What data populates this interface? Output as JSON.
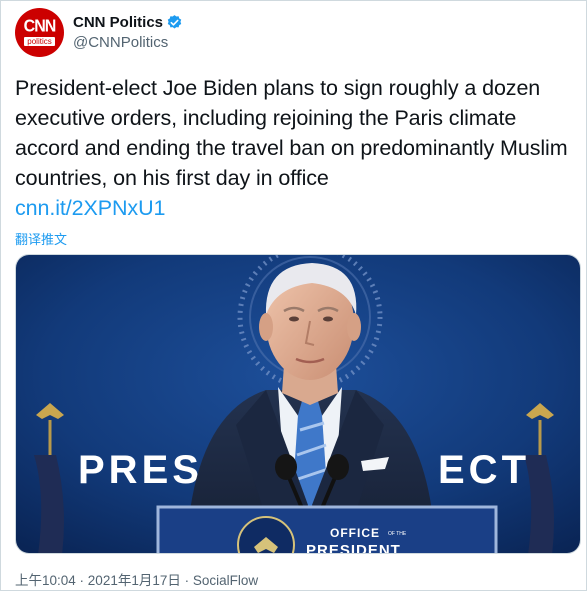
{
  "account": {
    "display_name": "CNN Politics",
    "handle": "@CNNPolitics",
    "avatar_logo": "CNN",
    "avatar_sub": "politics",
    "verified": true,
    "brand_color": "#cc0000"
  },
  "tweet": {
    "text": "President-elect Joe Biden plans to sign roughly a dozen executive orders, including rejoining the Paris climate accord and ending the travel ban on predominantly Muslim countries, on his first day in office",
    "link": "cnn.it/2XPNxU1",
    "translate_label": "翻译推文"
  },
  "media": {
    "backdrop_left": "PRES",
    "backdrop_right": "ECT",
    "podium_top": "OFFICE",
    "podium_of_the": "OF THE",
    "podium_bottom": "PRESIDENT"
  },
  "meta": {
    "time": "上午10:04",
    "separator": " · ",
    "date": "2021年1月17日",
    "source": "SocialFlow"
  },
  "colors": {
    "link": "#1d9bf0",
    "secondary_text": "#536471",
    "verified": "#1d9bf0"
  }
}
